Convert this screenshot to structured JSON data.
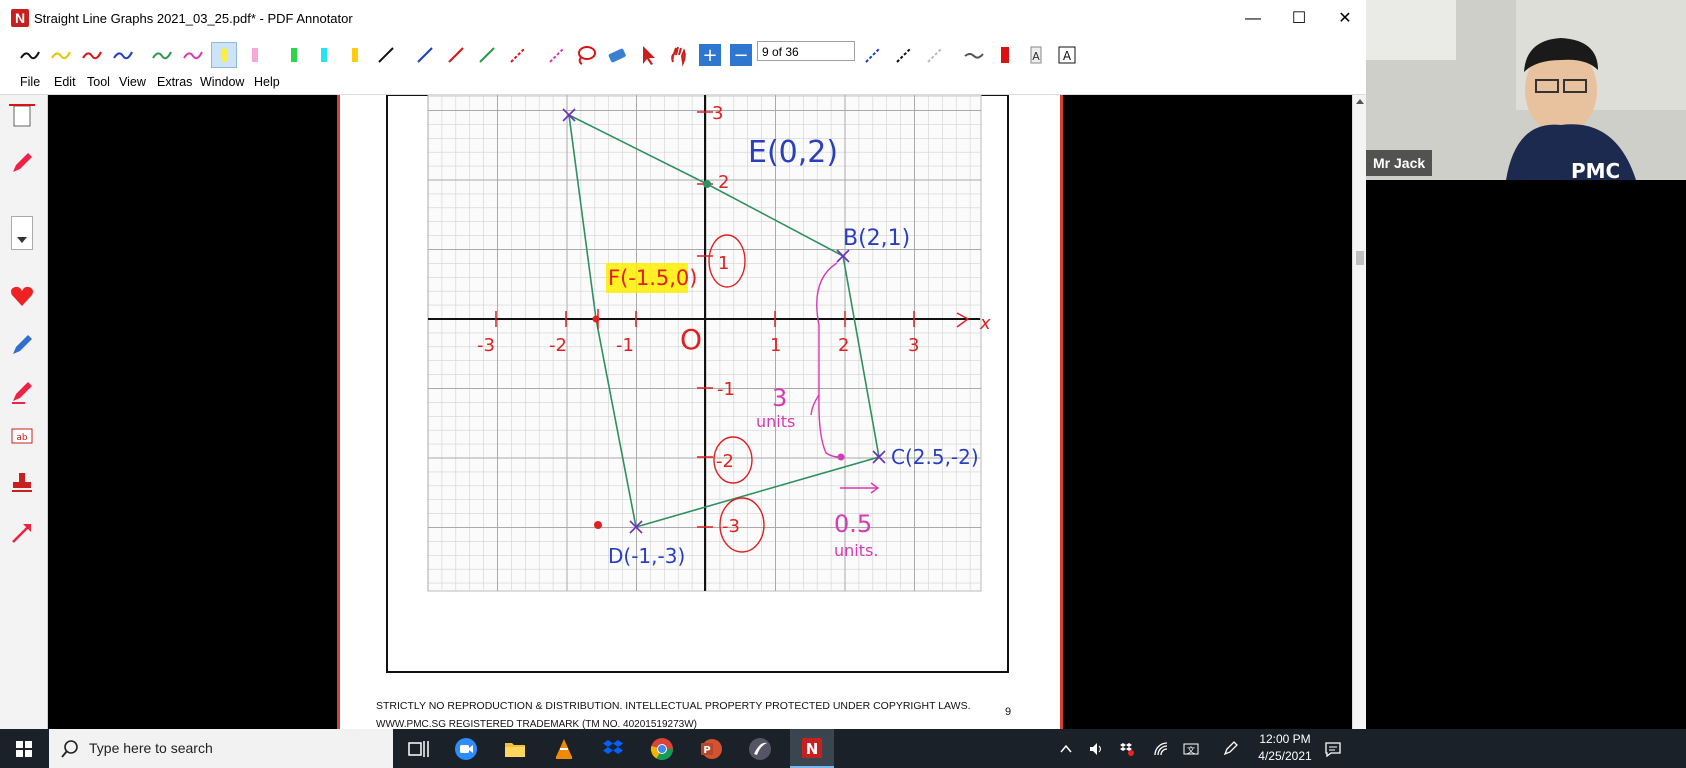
{
  "window": {
    "title": "Straight Line Graphs 2021_03_25.pdf* - PDF Annotator",
    "logo_letter": "N",
    "minimize_glyph": "—",
    "maximize_glyph": "☐",
    "close_glyph": "✕"
  },
  "toolbar": {
    "page_indicator": "9 of 36",
    "zoom_in_glyph": "+",
    "zoom_out_glyph": "−"
  },
  "menu": {
    "items": [
      "File",
      "Edit",
      "Tool",
      "View",
      "Extras",
      "Window",
      "Help"
    ]
  },
  "document": {
    "footer_line1": "STRICTLY NO REPRODUCTION & DISTRIBUTION. INTELLECTUAL PROPERTY PROTECTED UNDER COPYRIGHT LAWS.",
    "footer_line2": "WWW.PMC.SG REGISTERED TRADEMARK (TM NO. 40201519273W)",
    "page_number": "9",
    "annotations": {
      "pointE": "E(0,2)",
      "pointB": "B(2,1)",
      "pointF": "F(-1.5,0)",
      "pointC": "C(2.5,-2)",
      "pointD": "D(-1,-3)",
      "units3": "3",
      "units3b": "units",
      "units05": "0.5",
      "units05b": "units.",
      "origin": "O",
      "x_label": "x",
      "x_ticks": [
        "-3",
        "-2",
        "-1",
        "1",
        "2",
        "3"
      ],
      "y_ticks": [
        "3",
        "2",
        "1",
        "-1",
        "-2",
        "-3"
      ]
    }
  },
  "video": {
    "participant_name": "Mr Jack"
  },
  "taskbar": {
    "search_placeholder": "Type here to search",
    "time": "12:00 PM",
    "date": "4/25/2021"
  }
}
